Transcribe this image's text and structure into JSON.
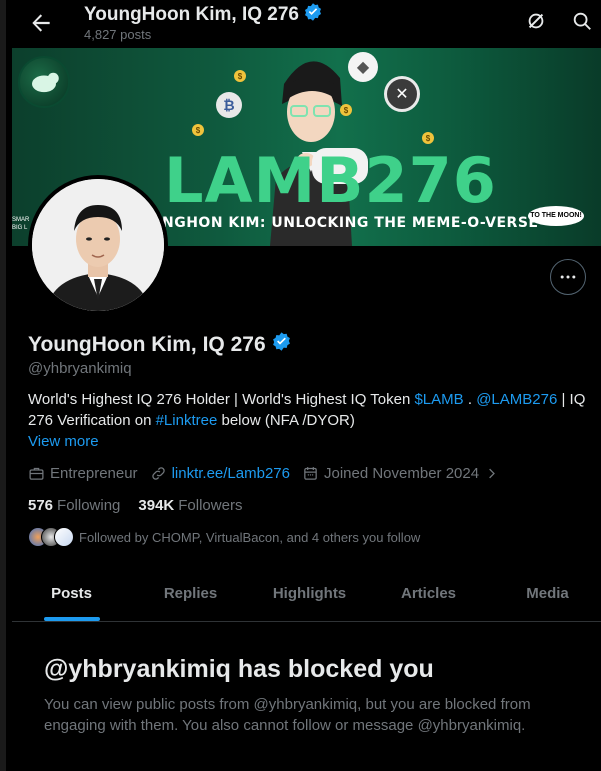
{
  "header": {
    "title": "YoungHoon Kim, IQ 276",
    "post_count": "4,827 posts"
  },
  "banner": {
    "title": "LAMB276",
    "subtitle": "NGHON KIM: UNLOCKING THE MEME-O-VERSE",
    "bubble": "TO THE MOON!",
    "side_text_1": "SMAR",
    "side_text_2": "BIG L"
  },
  "profile": {
    "name": "YoungHoon Kim, IQ 276",
    "handle": "@yhbryankimiq",
    "bio": {
      "part1": "World's Highest IQ 276 Holder | World's Highest IQ Token ",
      "link1": "$LAMB",
      "part2": " . ",
      "link2": "@LAMB276",
      "part3": " | IQ 276 Verification on ",
      "link3": "#Linktree",
      "part4": " below (NFA /DYOR)"
    },
    "view_more": "View more",
    "profession": "Entrepreneur",
    "website": "linktr.ee/Lamb276",
    "joined": "Joined November 2024",
    "following_count": "576",
    "following_label": "Following",
    "followers_count": "394K",
    "followers_label": "Followers",
    "followed_by": "Followed by CHOMP, VirtualBacon, and 4 others you follow"
  },
  "tabs": [
    "Posts",
    "Replies",
    "Highlights",
    "Articles",
    "Media"
  ],
  "blocked": {
    "title": "@yhbryankimiq has blocked you",
    "text": "You can view public posts from @yhbryankimiq, but you are blocked from engaging with them. You also cannot follow or message @yhbryankimiq."
  },
  "colors": {
    "accent": "#1d9bf0",
    "banner_text": "#3fd18a"
  }
}
